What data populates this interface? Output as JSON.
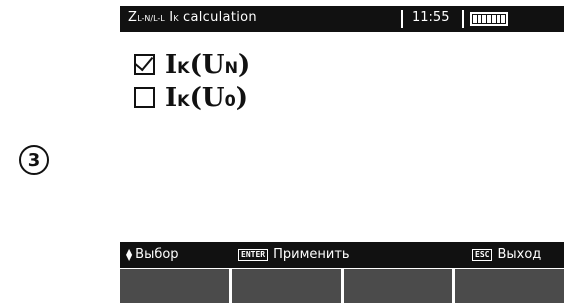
{
  "step_badge": "3",
  "header": {
    "title_main": "Z",
    "title_sub": "L-N/L-L",
    "title_mid": " I",
    "title_sub2": "K",
    "title_rest": " calculation",
    "time": "11:55",
    "battery_icon": "battery-full-icon"
  },
  "options": [
    {
      "checked": true,
      "main": "I",
      "sub": "K",
      "paren_open": "(U",
      "sub2": "N",
      "paren_close": ")"
    },
    {
      "checked": false,
      "main": "I",
      "sub": "K",
      "paren_open": "(U",
      "sub2": "0",
      "paren_close": ")"
    }
  ],
  "hints": {
    "select_label": "Выбор",
    "enter_key": "ENTER",
    "apply_label": "Применить",
    "esc_key": "ESC",
    "exit_label": "Выход"
  },
  "colors": {
    "bar": "#111111",
    "fkey": "#4b4b4b"
  }
}
